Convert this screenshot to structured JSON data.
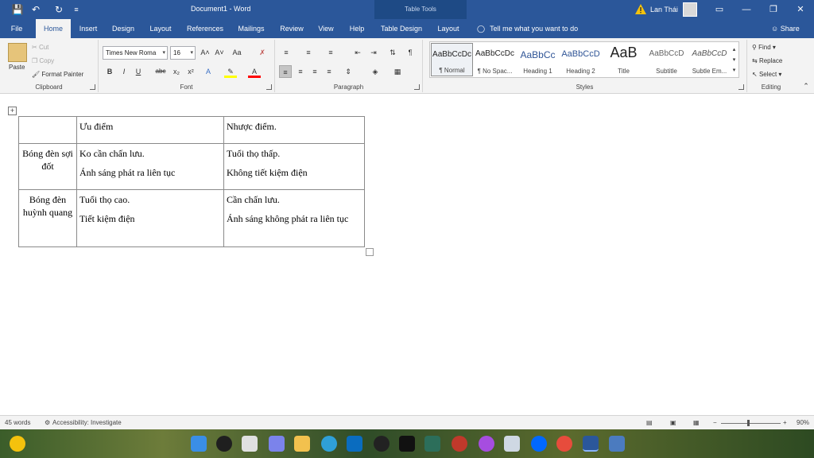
{
  "titlebar": {
    "title": "Document1 - Word",
    "table_tools": "Table Tools",
    "user": "Lan Thái"
  },
  "tabs": [
    {
      "label": "File"
    },
    {
      "label": "Home"
    },
    {
      "label": "Insert"
    },
    {
      "label": "Design"
    },
    {
      "label": "Layout"
    },
    {
      "label": "References"
    },
    {
      "label": "Mailings"
    },
    {
      "label": "Review"
    },
    {
      "label": "View"
    },
    {
      "label": "Help"
    },
    {
      "label": "Table Design"
    },
    {
      "label": "Layout"
    }
  ],
  "tellme": "Tell me what you want to do",
  "share": "Share",
  "clipboard": {
    "label": "Clipboard",
    "paste": "Paste",
    "cut": "Cut",
    "copy": "Copy",
    "format_painter": "Format Painter"
  },
  "font": {
    "label": "Font",
    "name": "Times New Roma",
    "size": "16"
  },
  "paragraph": {
    "label": "Paragraph"
  },
  "styles": {
    "label": "Styles",
    "items": [
      {
        "preview": "AaBbCcDc",
        "name": "¶ Normal"
      },
      {
        "preview": "AaBbCcDc",
        "name": "¶ No Spac..."
      },
      {
        "preview": "AaBbCc",
        "name": "Heading 1"
      },
      {
        "preview": "AaBbCcD",
        "name": "Heading 2"
      },
      {
        "preview": "AaB",
        "name": "Title"
      },
      {
        "preview": "AaBbCcD",
        "name": "Subtitle"
      },
      {
        "preview": "AaBbCcD",
        "name": "Subtle Em..."
      }
    ]
  },
  "editing": {
    "label": "Editing",
    "find": "Find",
    "replace": "Replace",
    "select": "Select"
  },
  "table": {
    "header": [
      "",
      "Ưu điểm",
      "Nhược điểm."
    ],
    "rows": [
      {
        "head": "Bóng đèn sợi đốt",
        "pros": [
          "Ko cần chấn lưu.",
          "Ánh sáng phát ra liên tục"
        ],
        "cons": [
          "Tuổi thọ thấp.",
          "Không tiết kiệm điện"
        ]
      },
      {
        "head": "Bóng đèn huỳnh quang",
        "pros": [
          "Tuổi thọ cao.",
          "Tiết kiệm điện"
        ],
        "cons": [
          "Cần chấn lưu.",
          "Ánh sáng không phát ra liên tục"
        ]
      }
    ]
  },
  "status": {
    "words": "45 words",
    "accessibility": "Accessibility: Investigate",
    "zoom": "90%"
  }
}
